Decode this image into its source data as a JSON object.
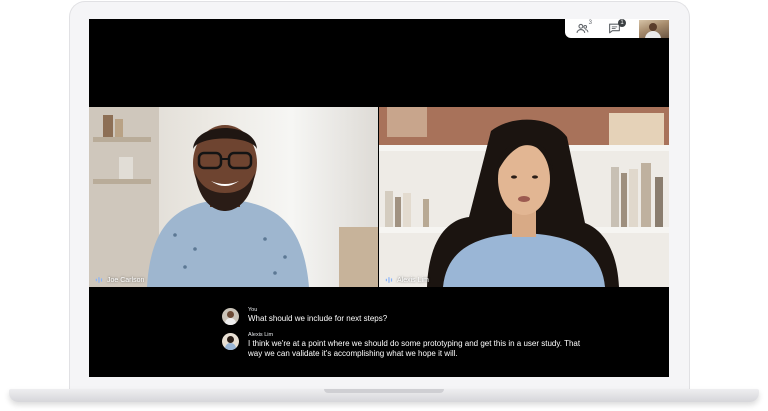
{
  "meeting": {
    "participants_count": "3",
    "chat_badge": "1"
  },
  "tiles": [
    {
      "name": "Joe Carlson"
    },
    {
      "name": "Alexis Lim"
    }
  ],
  "captions": [
    {
      "speaker": "You",
      "text": "What should we include for next steps?"
    },
    {
      "speaker": "Alexis Lim",
      "text": "I think we're at a point where we should do some prototyping and get this in a user study. That way we can validate it's accomplishing what we hope it will."
    }
  ],
  "icons": {
    "people": "people-icon",
    "chat": "chat-icon",
    "audio": "audio-wave-icon"
  }
}
